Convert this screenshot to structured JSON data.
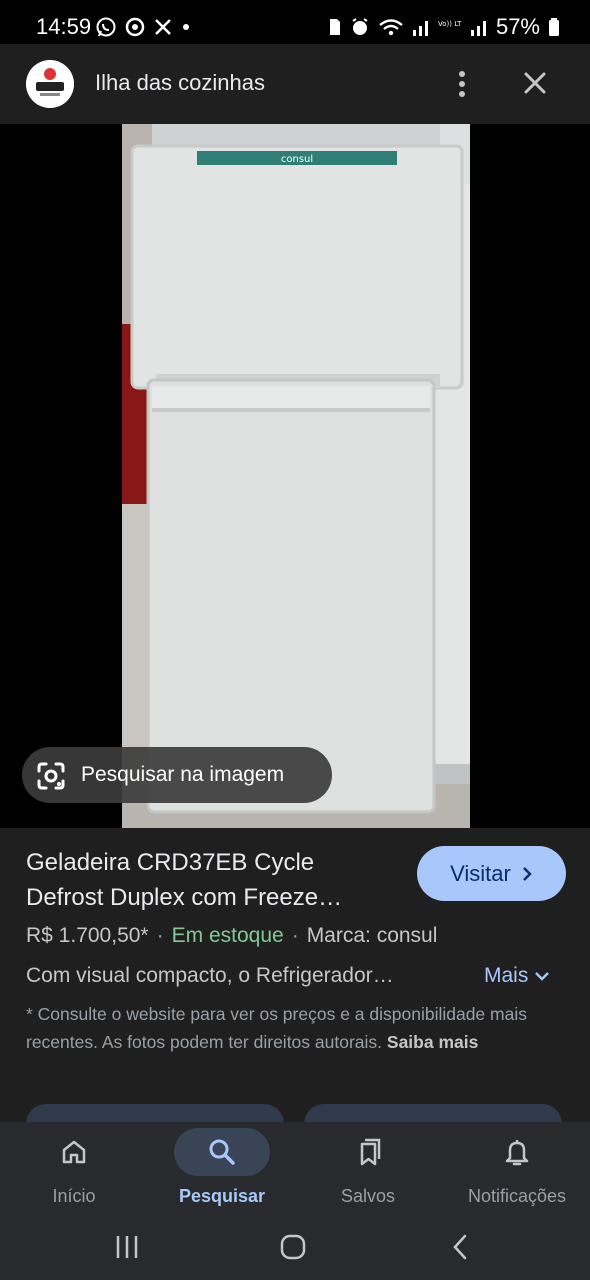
{
  "status_bar": {
    "time": "14:59",
    "battery": "57%",
    "network_label": "Vo)) LTE2",
    "icons": [
      "whatsapp-icon",
      "chrome-icon",
      "x-icon",
      "dot-icon",
      "sim-icon",
      "alarm-icon",
      "wifi-icon",
      "signal-icon",
      "battery-icon"
    ]
  },
  "header": {
    "site_name": "Ilha das cozinhas",
    "icons": [
      "site-logo",
      "more-vert-icon",
      "close-icon"
    ]
  },
  "image": {
    "brand_on_fridge": "consul",
    "lens_chip_label": "Pesquisar na imagem"
  },
  "product": {
    "title": "Geladeira CRD37EB Cycle Defrost Duplex com Freeze…",
    "visit_label": "Visitar",
    "price": "R$ 1.700,50*",
    "stock": "Em estoque",
    "brand": "Marca: consul",
    "description": "Com visual compacto, o Refrigerador…",
    "more_label": "Mais",
    "disclaimer": "* Consulte o website para ver os preços e a disponibilidade mais recentes. As fotos podem ter direitos autorais.",
    "learn_more": "Saiba mais"
  },
  "bottom_nav": {
    "items": [
      {
        "label": "Início",
        "icon": "home-icon"
      },
      {
        "label": "Pesquisar",
        "icon": "search-icon",
        "active": true
      },
      {
        "label": "Salvos",
        "icon": "bookmarks-icon"
      },
      {
        "label": "Notificações",
        "icon": "bell-icon"
      }
    ]
  },
  "colors": {
    "accent": "#a8c7fa",
    "stock_green": "#81c995",
    "surface": "#1f1f1f",
    "nav_surface": "#282a2d"
  }
}
